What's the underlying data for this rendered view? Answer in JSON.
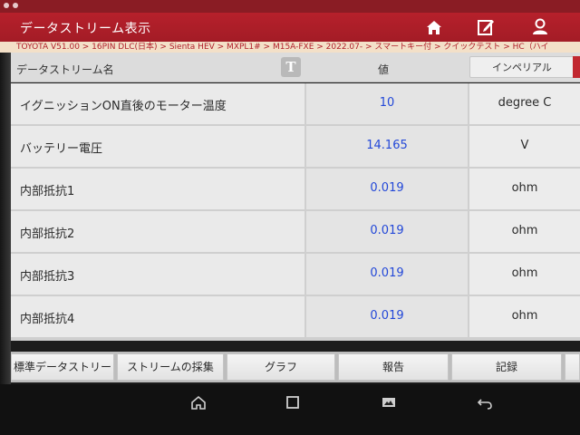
{
  "app": {
    "title": "データストリーム表示"
  },
  "breadcrumb": "TOYOTA V51.00 > 16PIN DLC(日本) > Sienta HEV > MXPL1# > M15A-FXE > 2022.07- > スマートキー付 > クイックテスト > HC（ハイ",
  "header": {
    "name_label": "データストリーム名",
    "text_toggle_label": "T",
    "value_label": "値",
    "unit_toggle_label": "インペリアル"
  },
  "rows": [
    {
      "name": "イグニッションON直後のモーター温度",
      "value": "10",
      "unit": "degree C"
    },
    {
      "name": "バッテリー電圧",
      "value": "14.165",
      "unit": "V"
    },
    {
      "name": "内部抵抗1",
      "value": "0.019",
      "unit": "ohm"
    },
    {
      "name": "内部抵抗2",
      "value": "0.019",
      "unit": "ohm"
    },
    {
      "name": "内部抵抗3",
      "value": "0.019",
      "unit": "ohm"
    },
    {
      "name": "内部抵抗4",
      "value": "0.019",
      "unit": "ohm"
    }
  ],
  "toolbar": {
    "standard_stream": "標準データストリー",
    "stream_sampling": "ストリームの採集",
    "graph": "グラフ",
    "report": "報告",
    "record": "記録"
  },
  "icons": {
    "home": "home-icon",
    "edit": "edit-icon",
    "user": "user-icon",
    "nav_home": "android-home-icon",
    "nav_recent": "recent-apps-icon",
    "nav_screenshot": "screenshot-icon",
    "nav_back": "back-icon"
  },
  "colors": {
    "brand_red": "#b6202b",
    "value_blue": "#2348d8",
    "breadcrumb_bg": "#f3e0c8"
  }
}
